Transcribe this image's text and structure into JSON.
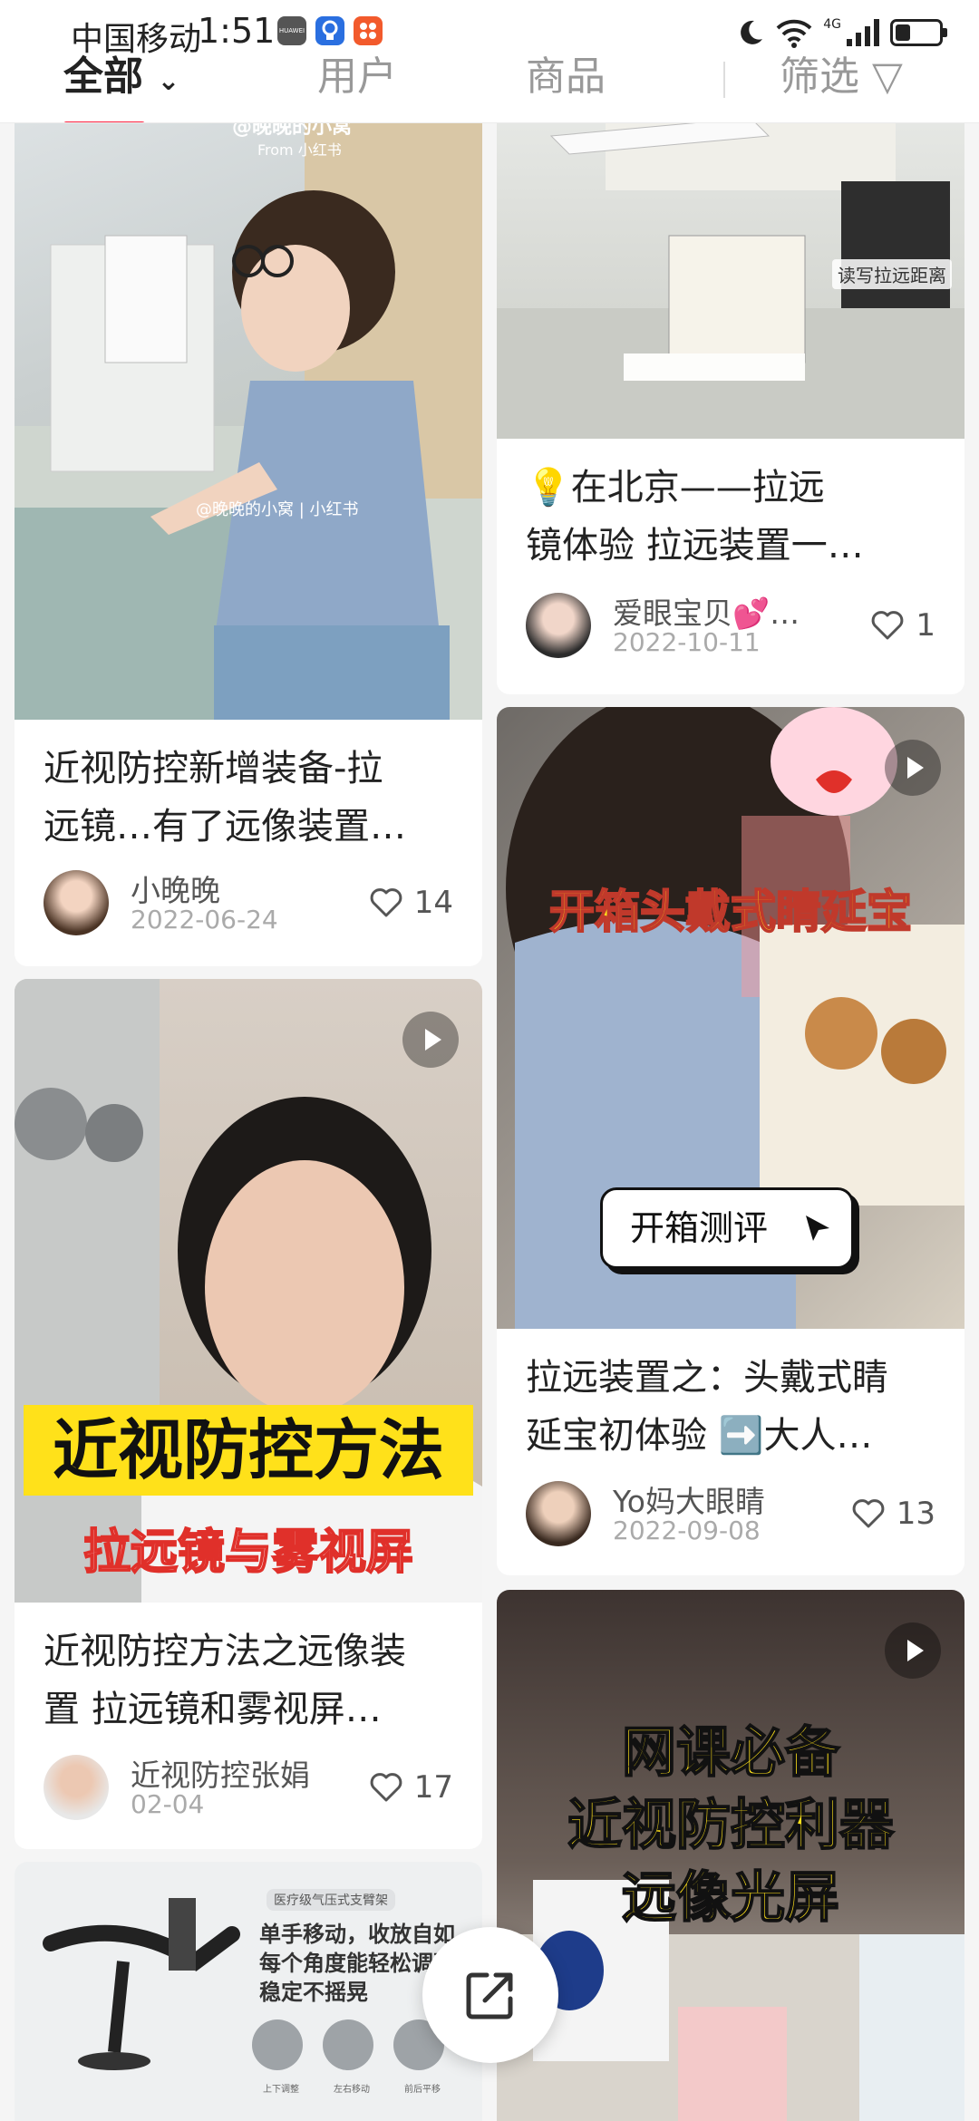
{
  "status_bar": {
    "carrier": "中国移动",
    "time": "1:51",
    "network": "4G",
    "app_icons": [
      {
        "name": "huawei-app-icon",
        "label": "HUAWEI",
        "color": "#555555"
      },
      {
        "name": "bulb-app-icon",
        "label": "",
        "color": "#2a6fe0"
      },
      {
        "name": "grid-app-icon",
        "label": "",
        "color": "#f25a2c"
      }
    ],
    "battery_level": 0.35
  },
  "tabs": [
    {
      "label": "全部",
      "active": true
    },
    {
      "label": "用户",
      "active": false
    },
    {
      "label": "商品",
      "active": false
    },
    {
      "label": "筛选",
      "active": false
    }
  ],
  "cards": [
    {
      "id": "c1",
      "image_desc_watermark": "@晚晚的小窝",
      "watermark_sub": "From 小红书",
      "watermark_mid": "@晚晚的小窝 | 小红书",
      "title_line1": "近视防控新增装备-拉",
      "title_line2": "远镜…有了远像装置…",
      "author": "小晚晚",
      "date": "2022-06-24",
      "likes": "14",
      "is_video": false
    },
    {
      "id": "c2",
      "overlay_tag": "读写拉远距离",
      "title_line1": "💡在北京——拉远",
      "title_line2": "镜体验 拉远装置一…",
      "author": "爱眼宝贝💕…",
      "date": "2022-10-11",
      "likes": "1",
      "is_video": false
    },
    {
      "id": "c3",
      "overlay_big": "近视防控方法",
      "overlay_sub": "拉远镜与雾视屏",
      "title_line1": "近视防控方法之远像装",
      "title_line2": "置 拉远镜和雾视屏…",
      "author": "近视防控张娟",
      "date": "02-04",
      "likes": "17",
      "is_video": true
    },
    {
      "id": "c4",
      "overlay_big": "开箱头戴式睛延宝",
      "overlay_button": "开箱测评",
      "title_line1": "拉远装置之：头戴式睛",
      "title_line2": "延宝初体验 ➡️大人…",
      "author": "Yo妈大眼睛",
      "date": "2022-09-08",
      "likes": "13",
      "is_video": true
    },
    {
      "id": "c5",
      "overlay_tag": "医疗级气压式支臂架",
      "overlay_lines": [
        "单手移动，收放自如",
        "每个角度能轻松调整",
        "稳定不摇晃"
      ],
      "overlay_icons": [
        "上下调整",
        "左右移动",
        "前后平移"
      ],
      "is_video": false
    },
    {
      "id": "c6",
      "overlay_lines": [
        "网课必备",
        "近视防控利器",
        "远像光屏"
      ],
      "is_video": true
    }
  ],
  "colors": {
    "accent": "#ff2442",
    "overlay_yellow": "#ffe11a",
    "overlay_red": "#e0302a"
  }
}
